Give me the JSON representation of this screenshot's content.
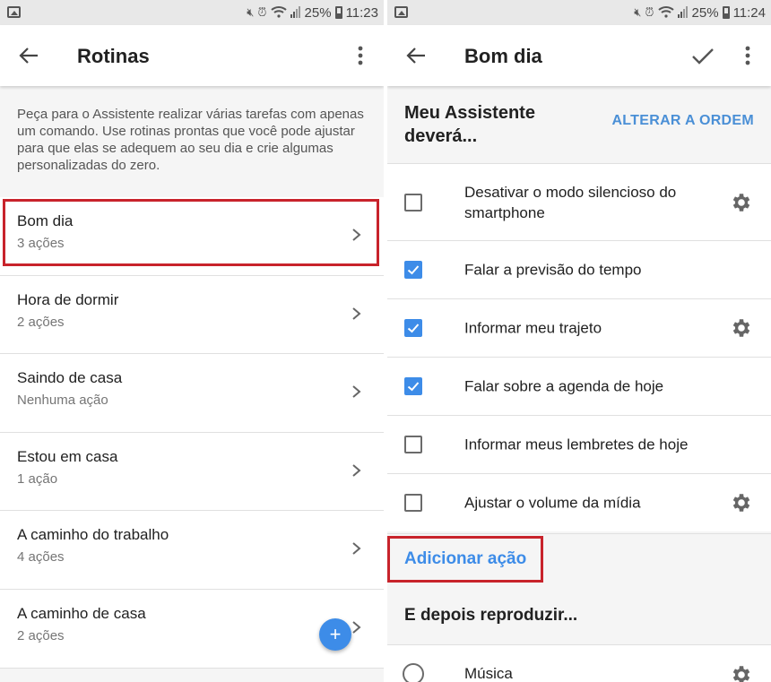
{
  "left": {
    "status": {
      "battery": "25%",
      "time": "11:23"
    },
    "title": "Rotinas",
    "intro": "Peça para o Assistente realizar várias tarefas com apenas um comando. Use rotinas prontas que você pode ajustar para que elas se adequem ao seu dia e crie algumas personalizadas do zero.",
    "routines": [
      {
        "name": "Bom dia",
        "count": "3 ações"
      },
      {
        "name": "Hora de dormir",
        "count": "2 ações"
      },
      {
        "name": "Saindo de casa",
        "count": "Nenhuma ação"
      },
      {
        "name": "Estou em casa",
        "count": "1 ação"
      },
      {
        "name": "A caminho do trabalho",
        "count": "4 ações"
      },
      {
        "name": "A caminho de casa",
        "count": "2 ações"
      }
    ],
    "fab_label": "+"
  },
  "right": {
    "status": {
      "battery": "25%",
      "time": "11:24"
    },
    "title": "Bom dia",
    "section_title": "Meu Assistente deverá...",
    "reorder": "ALTERAR A ORDEM",
    "actions": [
      {
        "label": "Desativar o modo silencioso do smartphone",
        "checked": false,
        "settings": true
      },
      {
        "label": "Falar a previsão do tempo",
        "checked": true,
        "settings": false
      },
      {
        "label": "Informar meu trajeto",
        "checked": true,
        "settings": true
      },
      {
        "label": "Falar sobre a agenda de hoje",
        "checked": true,
        "settings": false
      },
      {
        "label": "Informar meus lembretes de hoje",
        "checked": false,
        "settings": false
      },
      {
        "label": "Ajustar o volume da mídia",
        "checked": false,
        "settings": true
      }
    ],
    "add_action": "Adicionar ação",
    "then_title": "E depois reproduzir...",
    "media_option": "Música"
  },
  "colors": {
    "accent": "#3d8ce8",
    "highlight": "#c8232b",
    "link": "#4a8fd6"
  }
}
